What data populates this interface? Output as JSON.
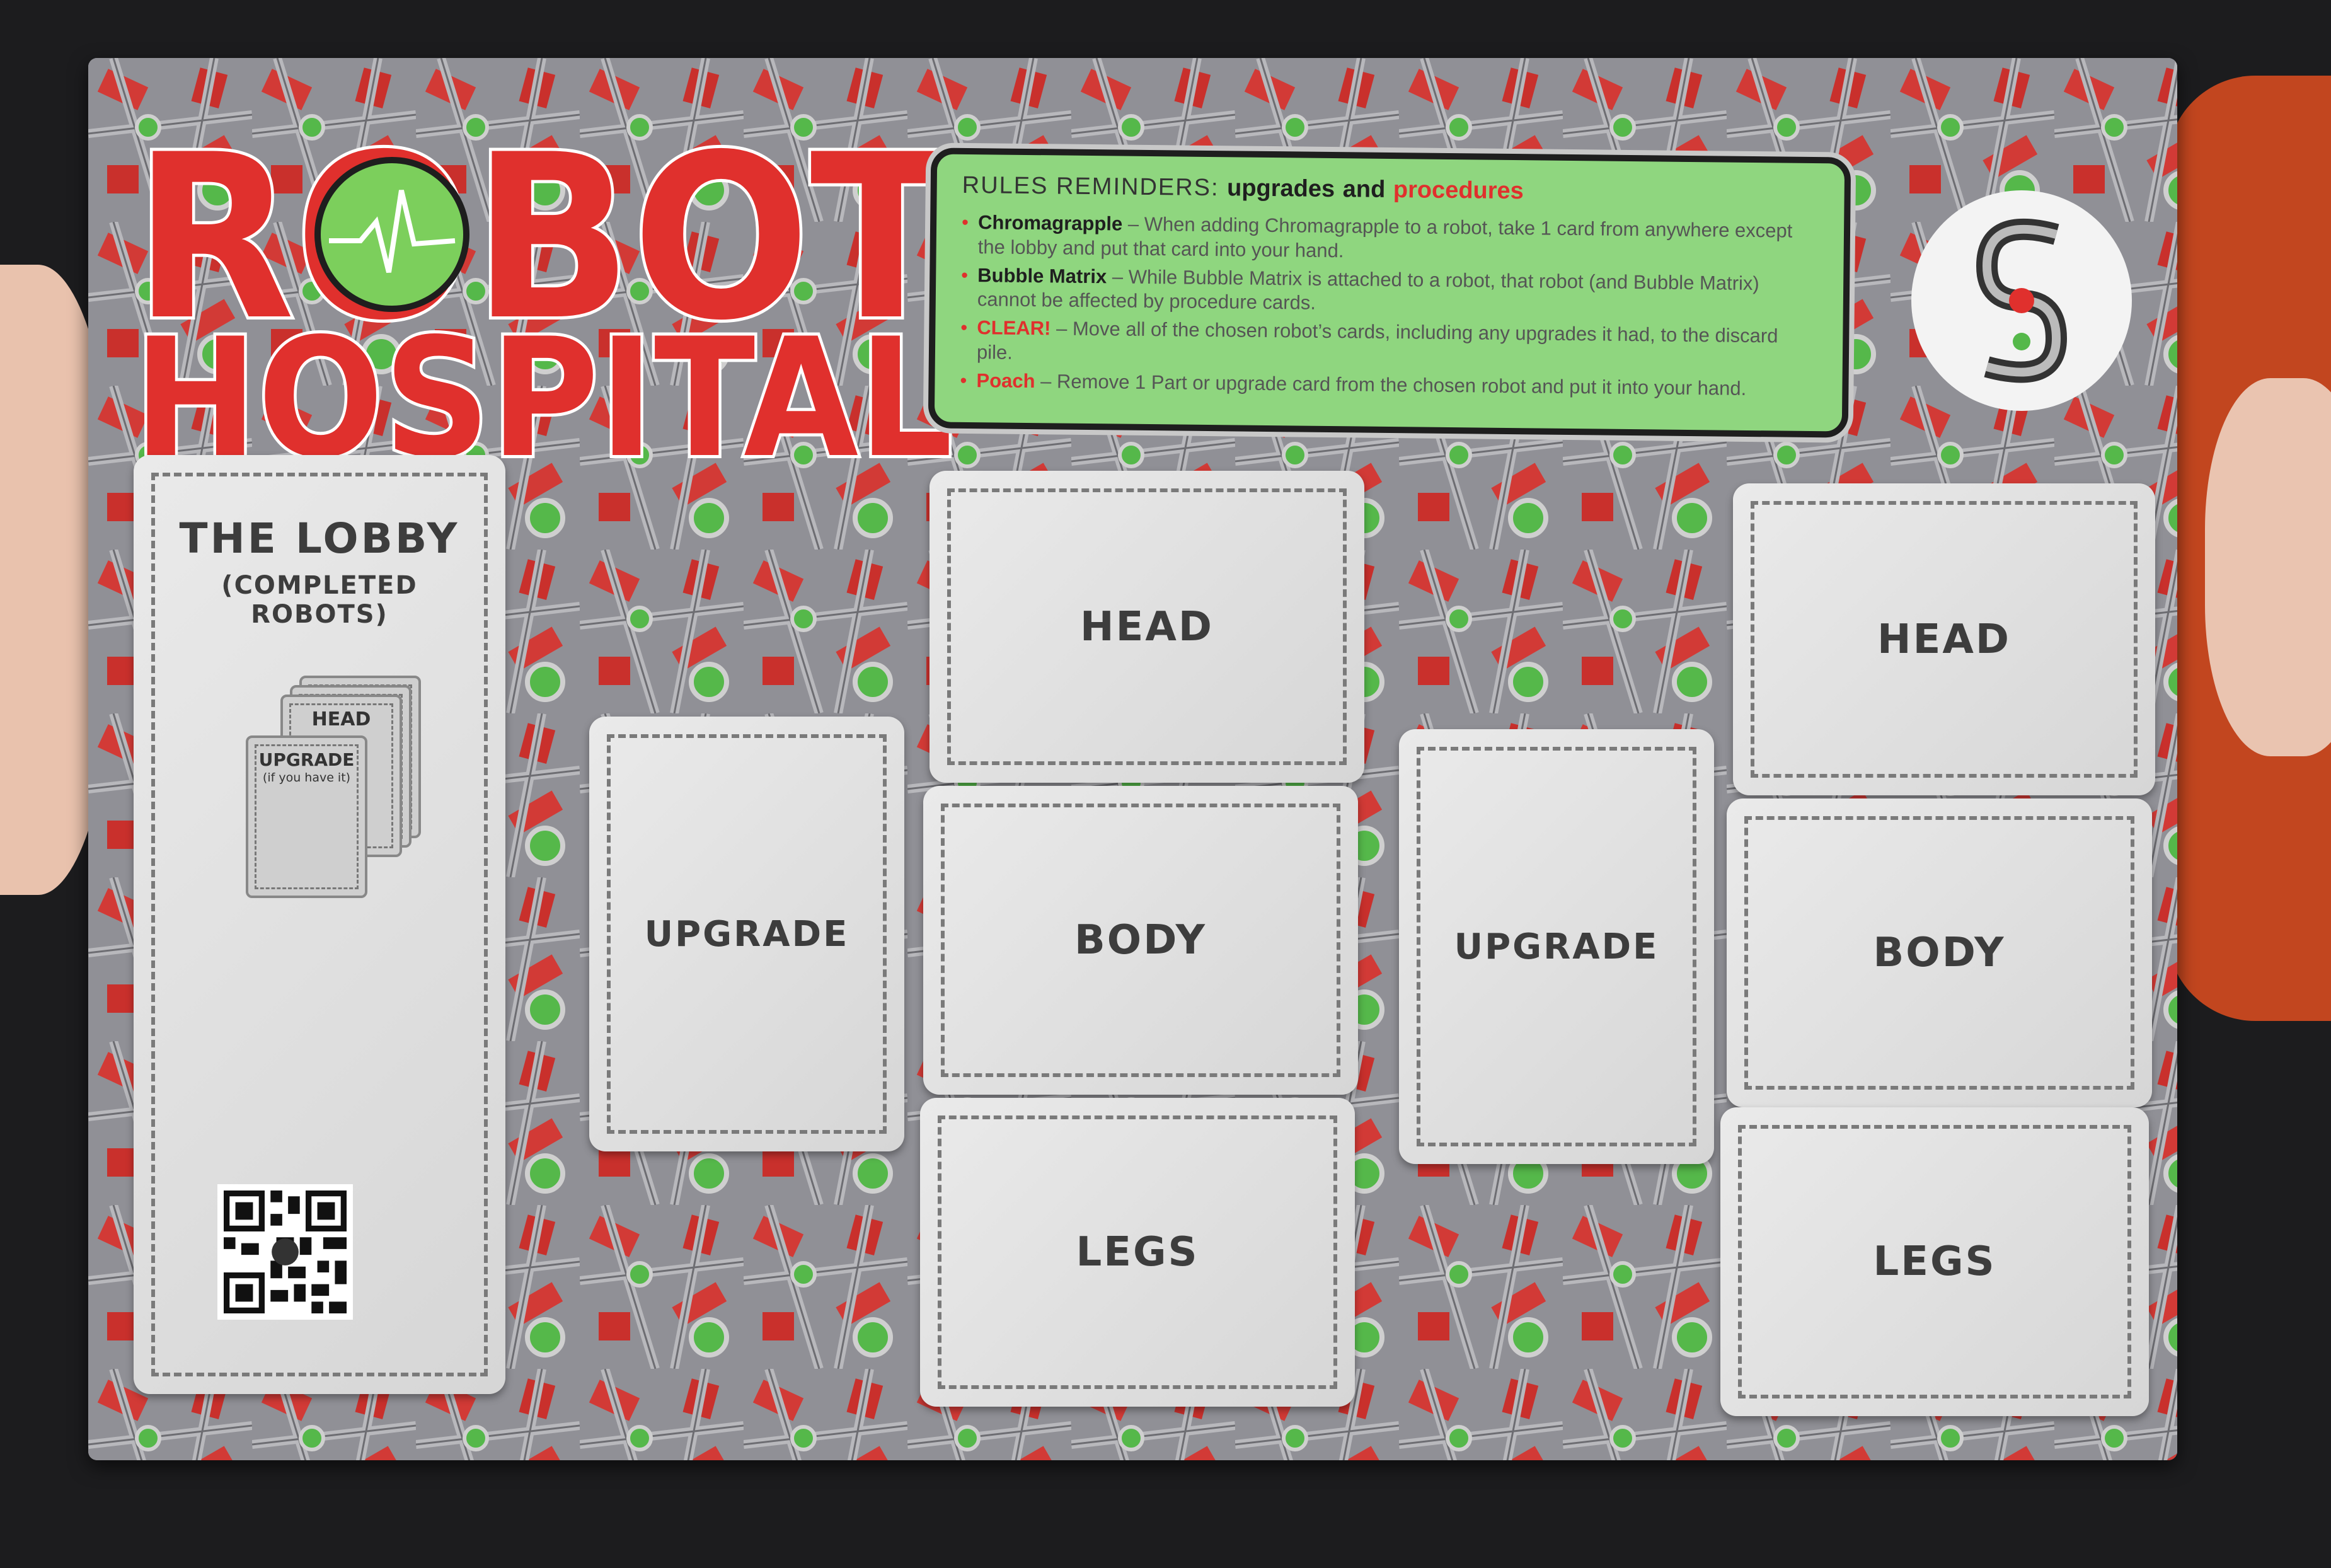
{
  "title": {
    "line1": "ROBOT",
    "line2": "HOSPITAL"
  },
  "rules": {
    "heading_prefix": "RULES REMINDERS:",
    "heading_upgrades": "upgrades",
    "heading_and": "and",
    "heading_procedures": "procedures",
    "items": [
      {
        "name": "Chromagrapple",
        "text": " – When adding Chromagrapple to a robot, take 1 card from anywhere except the lobby and put that card into your hand.",
        "highlight": false
      },
      {
        "name": "Bubble Matrix",
        "text": " – While Bubble Matrix is attached to a robot, that robot (and Bubble Matrix) cannot be affected by procedure cards.",
        "highlight": false
      },
      {
        "name": "CLEAR!",
        "text": " – Move all of the chosen robot’s cards, including any upgrades it had, to the discard pile.",
        "highlight": true
      },
      {
        "name": "Poach",
        "text": " – Remove 1 Part or upgrade card from the chosen robot and put it into your hand.",
        "highlight": true
      }
    ]
  },
  "lobby": {
    "title": "THE LOBBY",
    "subtitle": "(COMPLETED ROBOTS)",
    "mini_head": "HEAD",
    "mini_upgrade": "UPGRADE",
    "mini_note": "(if you have it)"
  },
  "slots": {
    "upgrade": "UPGRADE",
    "head": "HEAD",
    "body": "BODY",
    "legs": "LEGS"
  },
  "colors": {
    "brand_red": "#e0302d",
    "rules_green": "#8fd67f",
    "board_gray": "#8c8c91"
  },
  "icons": {
    "badge": "s-monogram-icon",
    "qr": "qr-code-icon"
  }
}
